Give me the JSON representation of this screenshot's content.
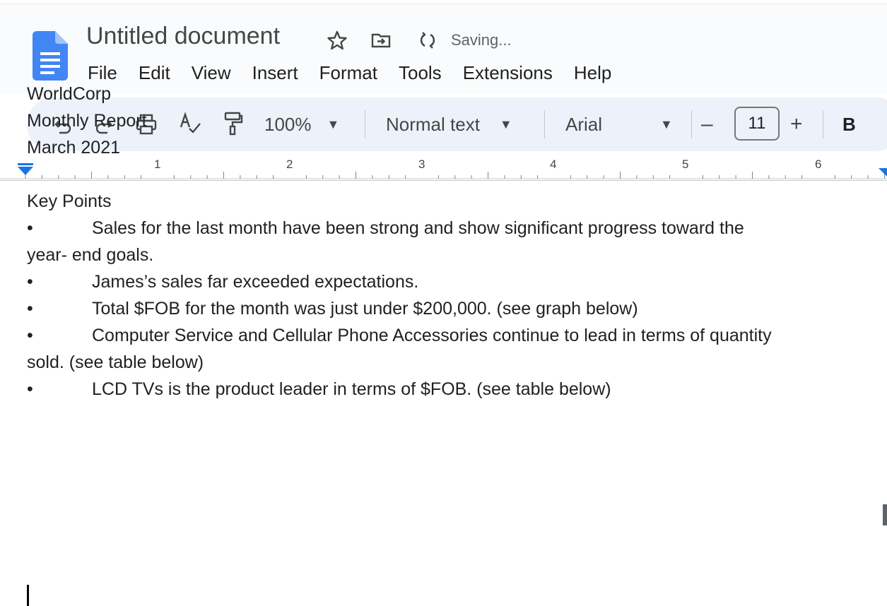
{
  "document": {
    "title": "Untitled document",
    "status": "Saving..."
  },
  "menu": [
    "File",
    "Edit",
    "View",
    "Insert",
    "Format",
    "Tools",
    "Extensions",
    "Help"
  ],
  "toolbar": {
    "zoom": "100%",
    "style": "Normal text",
    "font": "Arial",
    "font_size": "11",
    "minus": "–",
    "plus": "+",
    "bold": "B"
  },
  "icons": {
    "star": "star-icon",
    "move": "move-to-folder-icon",
    "sync": "saving-sync-icon",
    "undo": "undo-icon",
    "redo": "redo-icon",
    "print": "print-icon",
    "spellcheck": "spellcheck-icon",
    "paint_format": "paint-format-icon"
  },
  "ruler": {
    "numbers": [
      "1",
      "2",
      "3",
      "4",
      "5",
      "6"
    ]
  },
  "content": {
    "lines": [
      "WorldCorp",
      "Monthly Report",
      "March 2021"
    ],
    "heading": "Key Points",
    "bullet_symbol": "•",
    "bullets": [
      {
        "text": "Sales for the last month have been strong and show significant progress toward the",
        "continuation": "year- end goals."
      },
      {
        "text": "James’s sales far exceeded expectations."
      },
      {
        "text": "Total $FOB for the month was just under $200,000. (see graph below)"
      },
      {
        "text": "Computer Service and Cellular Phone Accessories continue to lead in terms of quantity",
        "continuation": "sold. (see table below)"
      },
      {
        "text": "LCD TVs is the product leader in terms of $FOB. (see table below)"
      }
    ]
  },
  "colors": {
    "header_bg": "#f9fbfd",
    "toolbar_bg": "#edf2fa",
    "docs_blue": "#4285f4",
    "ruler_marker": "#1a73e8"
  }
}
